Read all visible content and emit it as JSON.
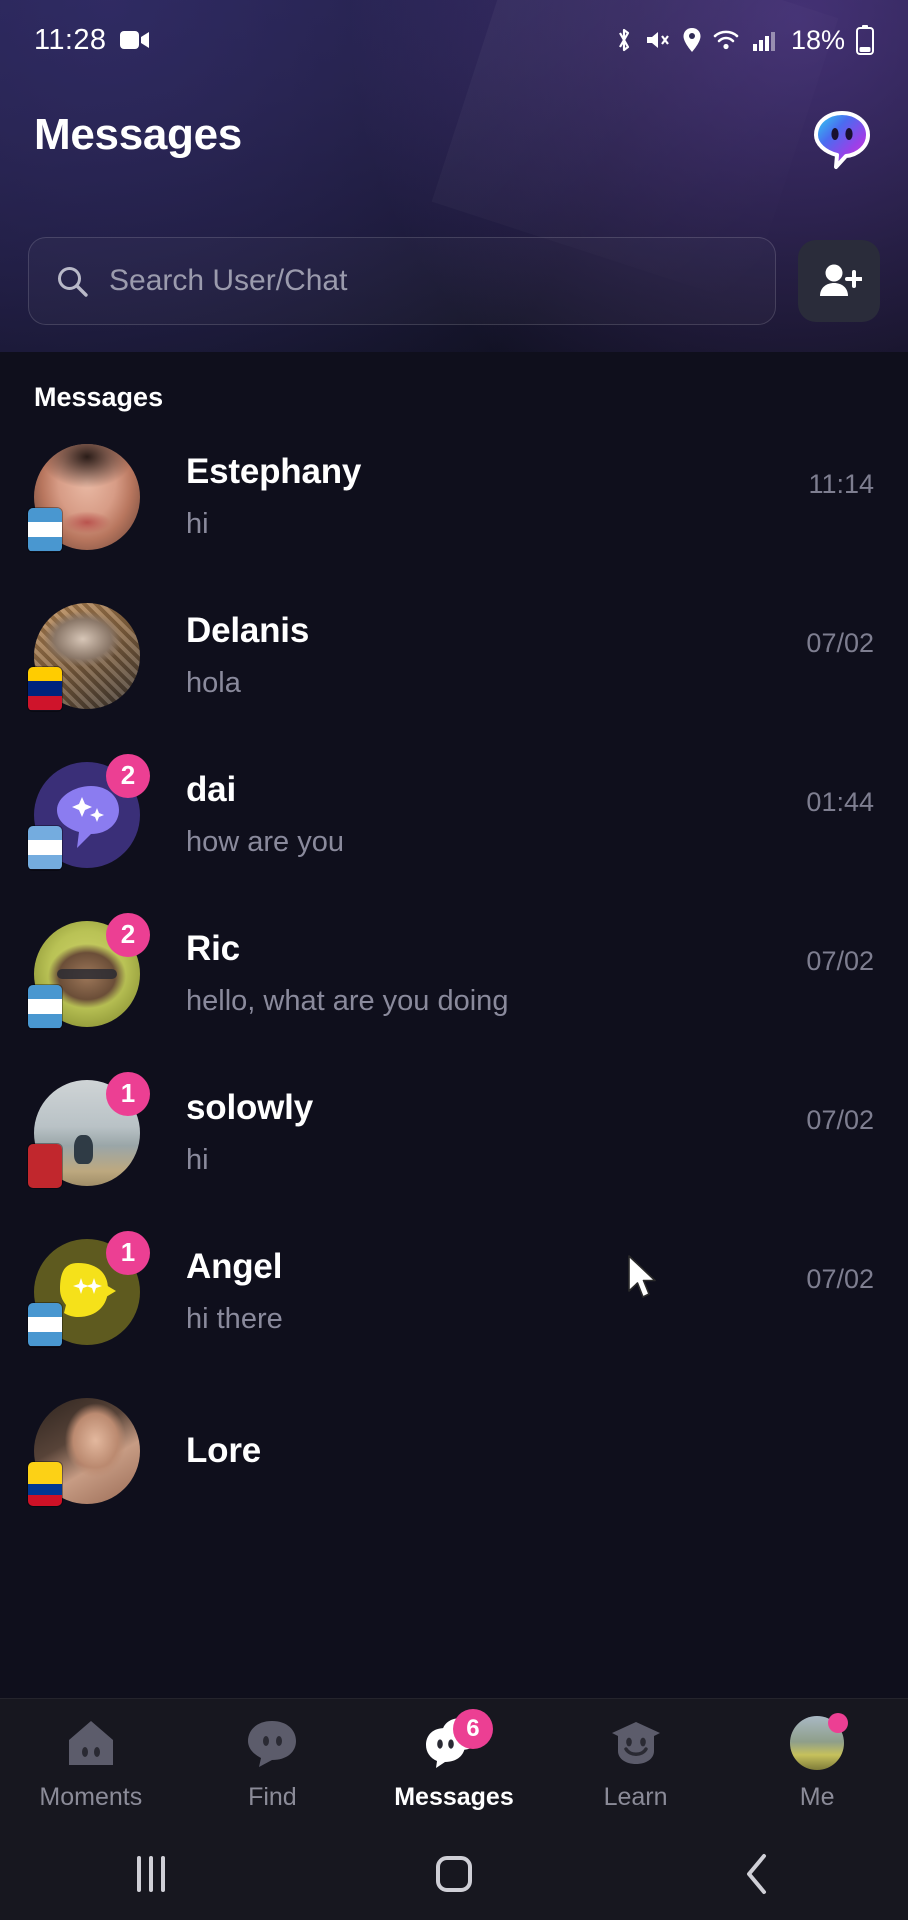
{
  "status_bar": {
    "time": "11:28",
    "battery_percent": "18%",
    "icons": [
      "video-record-icon",
      "bluetooth-icon",
      "mute-icon",
      "location-icon",
      "wifi-icon",
      "cellular-signal-icon",
      "battery-icon"
    ]
  },
  "header": {
    "title": "Messages",
    "logo": "app-logo-speech-bubble"
  },
  "search": {
    "placeholder": "Search User/Chat",
    "value": "",
    "icon": "search-icon",
    "add_user_icon": "add-user-icon"
  },
  "list": {
    "section_label": "Messages",
    "items": [
      {
        "name": "Estephany",
        "preview": "hi",
        "time": "11:14",
        "badge": "",
        "flag": "gt",
        "avatar": "photo-estephany"
      },
      {
        "name": "Delanis",
        "preview": "hola",
        "time": "07/02",
        "badge": "",
        "flag": "ve",
        "avatar": "photo-delanis"
      },
      {
        "name": "dai",
        "preview": "how are you",
        "time": "01:44",
        "badge": "2",
        "flag": "ar",
        "avatar": "default-bubble-purple"
      },
      {
        "name": "Ric",
        "preview": "hello, what are you doing",
        "time": "07/02",
        "badge": "2",
        "flag": "gt",
        "avatar": "photo-ric"
      },
      {
        "name": "solowly",
        "preview": "hi",
        "time": "07/02",
        "badge": "1",
        "flag": "ma",
        "avatar": "photo-solowly"
      },
      {
        "name": "Angel",
        "preview": "hi there",
        "time": "07/02",
        "badge": "1",
        "flag": "gt",
        "avatar": "default-bubble-yellow"
      },
      {
        "name": "Lore",
        "preview": "",
        "time": "",
        "badge": "",
        "flag": "co",
        "avatar": "photo-lore"
      }
    ]
  },
  "bottom_nav": {
    "items": [
      {
        "label": "Moments",
        "icon": "home-icon",
        "badge": "",
        "active": false
      },
      {
        "label": "Find",
        "icon": "chat-bubble-icon",
        "badge": "",
        "active": false
      },
      {
        "label": "Messages",
        "icon": "messages-bubbles-icon",
        "badge": "6",
        "active": true
      },
      {
        "label": "Learn",
        "icon": "graduation-cap-icon",
        "badge": "",
        "active": false
      },
      {
        "label": "Me",
        "icon": "profile-avatar-icon",
        "badge": "dot",
        "active": false
      }
    ]
  },
  "android_nav": {
    "recents": "recents-icon",
    "home": "home-button-icon",
    "back": "back-icon"
  },
  "colors": {
    "accent_pink": "#ec3f93",
    "background": "#0f0f1c",
    "nav_background": "#17171f",
    "text_primary": "#ffffff",
    "text_secondary": "#8a8a9c"
  }
}
